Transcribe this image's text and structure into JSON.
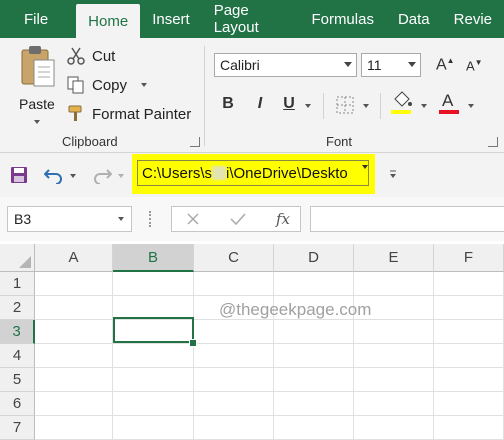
{
  "menu": {
    "tabs": [
      "File",
      "Home",
      "Insert",
      "Page Layout",
      "Formulas",
      "Data",
      "Revie"
    ],
    "active": "Home"
  },
  "ribbon": {
    "clipboard": {
      "paste": "Paste",
      "cut": "Cut",
      "copy": "Copy",
      "format_painter": "Format Painter",
      "group_label": "Clipboard"
    },
    "font": {
      "family": "Calibri",
      "size": "11",
      "bold": "B",
      "italic": "I",
      "underline": "U",
      "font_color_letter": "A",
      "group_label": "Font"
    }
  },
  "qat": {
    "path": "C:\\Users\\s",
    "path_rest": "i\\OneDrive\\Deskto"
  },
  "formula_bar": {
    "name_box": "B3",
    "fx": "fx"
  },
  "grid": {
    "columns": [
      "A",
      "B",
      "C",
      "D",
      "E",
      "F"
    ],
    "rows": [
      "1",
      "2",
      "3",
      "4",
      "5",
      "6",
      "7"
    ],
    "selected_column": "B",
    "selected_row": "3"
  },
  "watermark": "@thegeekpage.com",
  "colors": {
    "brand": "#217346",
    "highlight": "#ffff00",
    "font_color": "#e81123"
  }
}
